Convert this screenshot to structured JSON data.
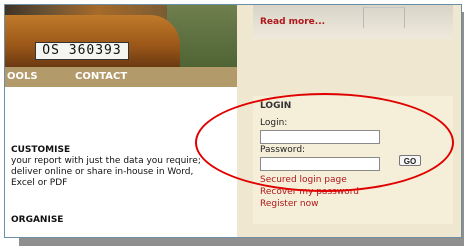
{
  "hero": {
    "plate_text": "OS 360393"
  },
  "nav": {
    "tools_label": "OOLS",
    "contact_label": "CONTACT"
  },
  "teaser": {
    "read_more": "Read more..."
  },
  "content": {
    "customise_heading": "CUSTOMISE",
    "customise_text": "your report with just the data you require; deliver online or share in-house in Word, Excel or PDF",
    "organise_heading": "ORGANISE"
  },
  "login": {
    "title": "LOGIN",
    "login_label": "Login:",
    "login_value": "",
    "password_label": "Password:",
    "password_value": "",
    "go_label": "GO",
    "secured_link": "Secured login page",
    "recover_link": "Recover my password",
    "register_link": "Register now"
  },
  "colors": {
    "link_red": "#b0171c",
    "highlight_red": "#e00000",
    "nav_tan": "#b39a6a",
    "sidebar_bg": "#efe7cf"
  }
}
